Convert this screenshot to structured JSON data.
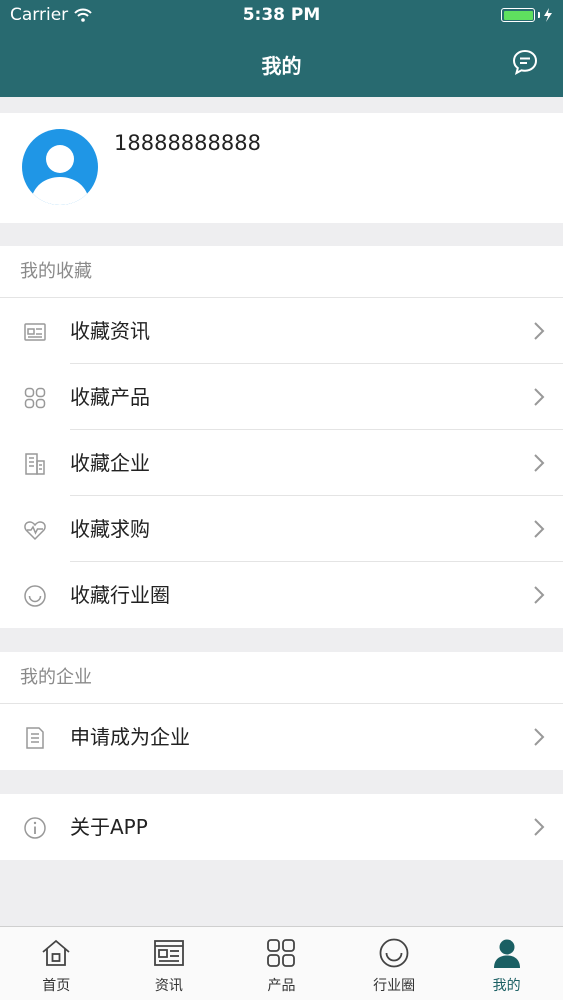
{
  "status_bar": {
    "carrier": "Carrier",
    "time": "5:38 PM"
  },
  "nav": {
    "title": "我的"
  },
  "profile": {
    "phone": "18888888888"
  },
  "favorites": {
    "title": "我的收藏",
    "items": [
      {
        "label": "收藏资讯",
        "icon": "news-icon"
      },
      {
        "label": "收藏产品",
        "icon": "grid-icon"
      },
      {
        "label": "收藏企业",
        "icon": "building-icon"
      },
      {
        "label": "收藏求购",
        "icon": "heartbeat-icon"
      },
      {
        "label": "收藏行业圈",
        "icon": "circle-smile-icon"
      }
    ]
  },
  "company": {
    "title": "我的企业",
    "items": [
      {
        "label": "申请成为企业",
        "icon": "document-icon"
      }
    ]
  },
  "about": {
    "label": "关于APP",
    "icon": "info-icon"
  },
  "tabbar": {
    "items": [
      {
        "label": "首页",
        "icon": "home-icon"
      },
      {
        "label": "资讯",
        "icon": "news-icon"
      },
      {
        "label": "产品",
        "icon": "grid-icon"
      },
      {
        "label": "行业圈",
        "icon": "circle-smile-icon"
      },
      {
        "label": "我的",
        "icon": "person-icon"
      }
    ],
    "active_index": 4
  },
  "colors": {
    "header": "#286a70",
    "active_tab": "#1a5f63",
    "avatar": "#1f96e6",
    "background": "#eeeef0"
  }
}
